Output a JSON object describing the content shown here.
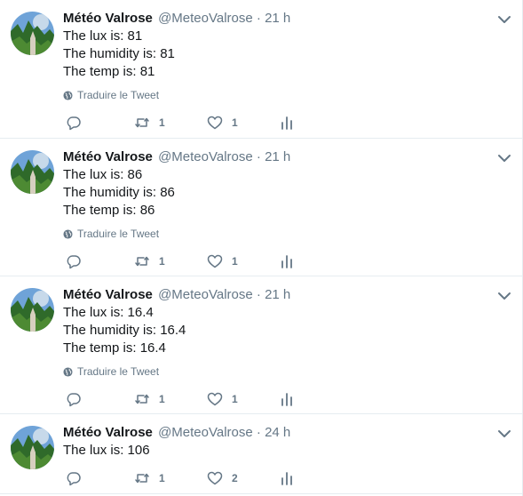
{
  "translate_label": "Traduire le Tweet",
  "colors": {
    "icon": "#657786",
    "divider": "#e6ecf0",
    "text": "#14171a"
  },
  "tweets": [
    {
      "name": "Météo Valrose",
      "handle": "@MeteoValrose",
      "separator": "·",
      "time": "21 h",
      "lines": [
        "The lux is: 81",
        "The humidity is: 81",
        "The temp is: 81"
      ],
      "retweets": "1",
      "likes": "1"
    },
    {
      "name": "Météo Valrose",
      "handle": "@MeteoValrose",
      "separator": "·",
      "time": "21 h",
      "lines": [
        "The lux is: 86",
        "The humidity is: 86",
        "The temp is: 86"
      ],
      "retweets": "1",
      "likes": "1"
    },
    {
      "name": "Météo Valrose",
      "handle": "@MeteoValrose",
      "separator": "·",
      "time": "21 h",
      "lines": [
        "The lux is: 16.4",
        "The humidity is: 16.4",
        "The temp is: 16.4"
      ],
      "retweets": "1",
      "likes": "1"
    },
    {
      "name": "Météo Valrose",
      "handle": "@MeteoValrose",
      "separator": "·",
      "time": "24 h",
      "lines": [
        "The lux is: 106"
      ],
      "retweets": "1",
      "likes": "2"
    }
  ]
}
